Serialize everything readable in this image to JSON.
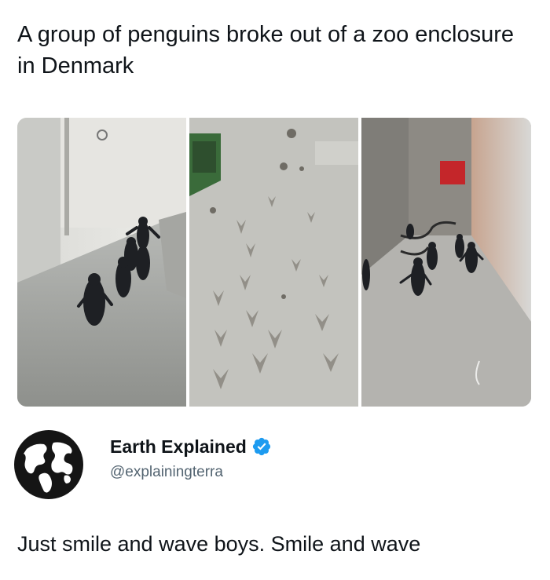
{
  "post": {
    "headline": "A group of penguins broke out of a zoo enclosure in Denmark",
    "media": [
      {
        "alt_icon": "penguins-corridor-image"
      },
      {
        "alt_icon": "footprints-image"
      },
      {
        "alt_icon": "penguins-hallway-image"
      }
    ]
  },
  "author": {
    "display_name": "Earth Explained",
    "handle": "@explainingterra",
    "verified": true,
    "avatar_icon": "globe-icon",
    "verified_color": "#1d9bf0"
  },
  "tweet": {
    "text": "Just smile and wave boys. Smile and wave"
  }
}
